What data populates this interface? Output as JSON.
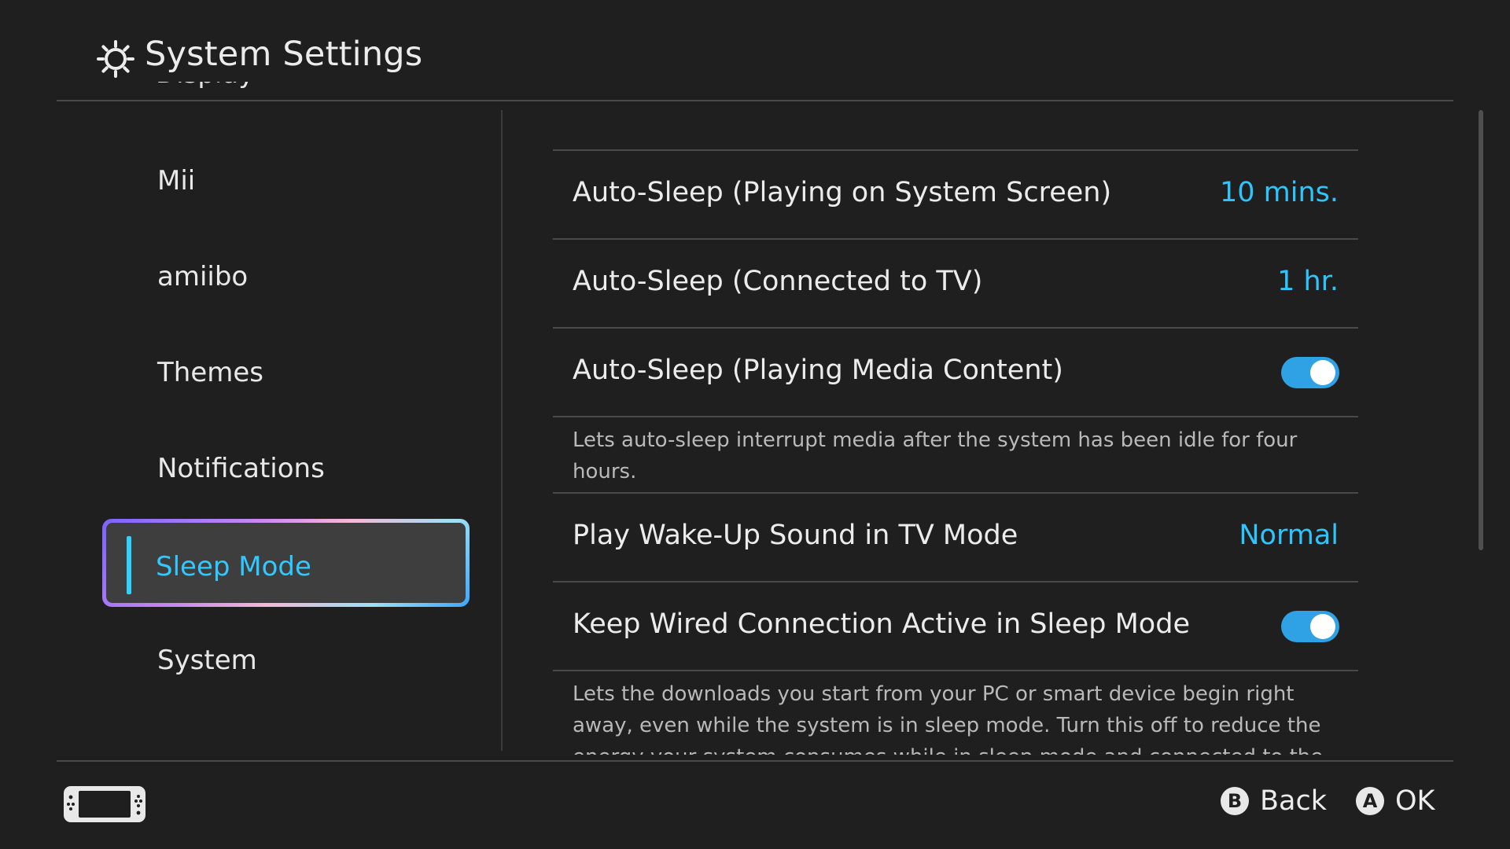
{
  "header": {
    "title": "System Settings",
    "icon": "gear-icon",
    "clipped_item": "Display"
  },
  "sidebar": {
    "items": [
      {
        "label": "Mii"
      },
      {
        "label": "amiibo"
      },
      {
        "label": "Themes"
      },
      {
        "label": "Notifications"
      },
      {
        "label": "Sleep Mode",
        "selected": true
      },
      {
        "label": "System"
      }
    ]
  },
  "main": {
    "settings": [
      {
        "label": "Auto-Sleep (Playing on System Screen)",
        "value": "10 mins."
      },
      {
        "label": "Auto-Sleep (Connected to TV)",
        "value": "1 hr."
      },
      {
        "label": "Auto-Sleep (Playing Media Content)",
        "toggle": true,
        "description": "Lets auto-sleep interrupt media after the system has been idle for four hours."
      },
      {
        "label": "Play Wake-Up Sound in TV Mode",
        "value": "Normal"
      },
      {
        "label": "Keep Wired Connection Active in Sleep Mode",
        "toggle": true,
        "description": "Lets the downloads you start from your PC or smart device begin right away, even while the system is in sleep mode. Turn this off to reduce the energy your system consumes while in sleep mode and connected to the internet."
      }
    ]
  },
  "footer": {
    "console_icon": "console-icon",
    "back_button": "B",
    "back_label": "Back",
    "ok_button": "A",
    "ok_label": "OK"
  },
  "colors": {
    "background": "#1f1f1f",
    "accent": "#2ec5ff",
    "toggle_on": "#2fa2e6",
    "text": "#ececec",
    "description": "#b9b9b9"
  }
}
